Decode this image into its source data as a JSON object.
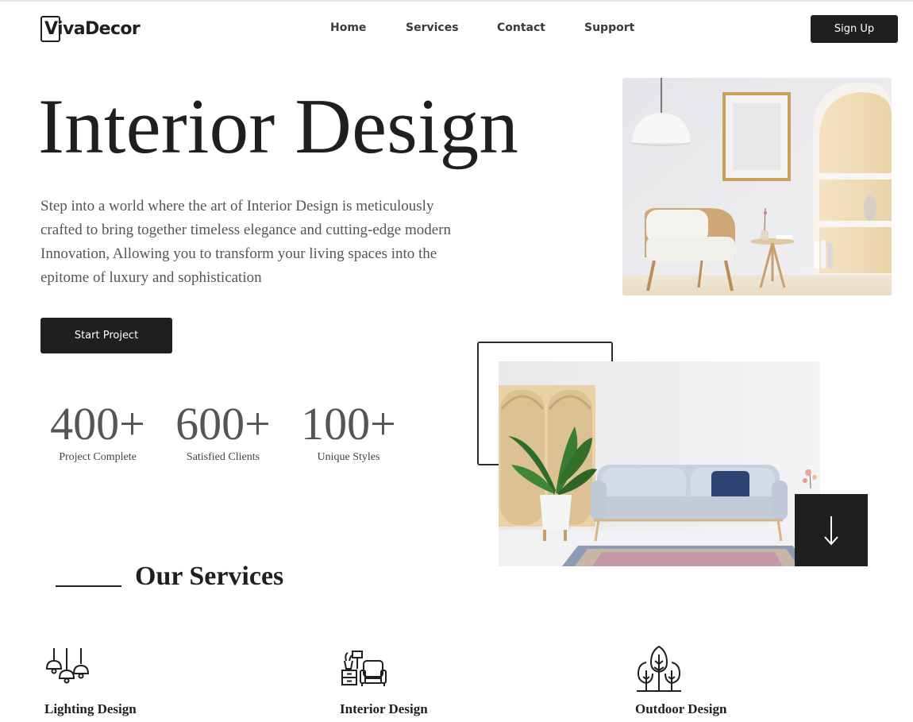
{
  "brand": {
    "name": "VivaDecor"
  },
  "nav": {
    "items": [
      {
        "label": "Home"
      },
      {
        "label": "Services"
      },
      {
        "label": "Contact"
      },
      {
        "label": "Support"
      }
    ],
    "signup_label": "Sign Up"
  },
  "hero": {
    "title": "Interior Design",
    "description": "Step into a world where the art of Interior Design is meticulously crafted to bring together timeless elegance and cutting-edge modern Innovation, Allowing you to transform your living spaces into the epitome of luxury and sophistication",
    "cta_label": "Start Project"
  },
  "stats": [
    {
      "value": "400+",
      "label": "Project Complete"
    },
    {
      "value": "600+",
      "label": "Satisfied Clients"
    },
    {
      "value": "100+",
      "label": "Unique Styles"
    }
  ],
  "scroll_icon": "arrow-down-icon",
  "services": {
    "heading": "Our Services",
    "items": [
      {
        "name": "Lighting Design",
        "icon": "pendant-lamps-icon"
      },
      {
        "name": "Interior Design",
        "icon": "furniture-icon"
      },
      {
        "name": "Outdoor Design",
        "icon": "trees-icon"
      }
    ]
  },
  "colors": {
    "primary_dark": "#1f1f1f",
    "text_gray": "#555555",
    "background": "#ffffff"
  }
}
